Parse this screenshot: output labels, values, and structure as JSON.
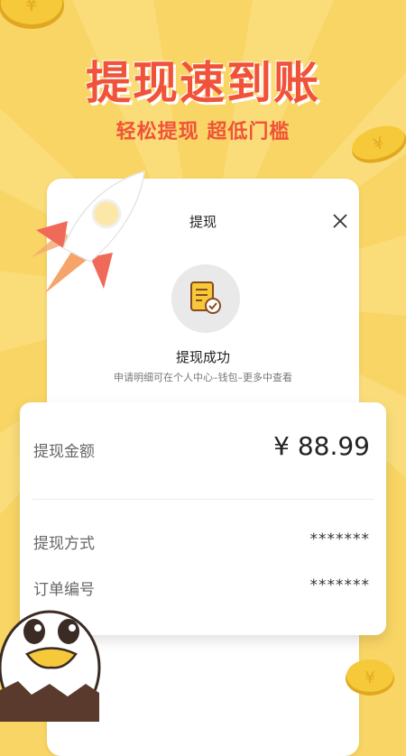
{
  "banner": {
    "headline": "提现速到账",
    "subline": "轻松提现 超低门槛"
  },
  "dialog": {
    "title": "提现",
    "success_title": "提现成功",
    "success_hint": "申请明细可在个人中心–钱包–更多中查看"
  },
  "details": {
    "amount_label": "提现金额",
    "amount_value": "¥ 88.99",
    "method_label": "提现方式",
    "method_value": "*******",
    "order_label": "订单编号",
    "order_value": "*******"
  },
  "colors": {
    "background": "#f8d564",
    "headline": "#f0533a",
    "coin": "#f2c230"
  },
  "icons": [
    "close-icon",
    "receipt-check-icon",
    "rocket-icon",
    "coin-icon",
    "chick-mascot-icon"
  ]
}
